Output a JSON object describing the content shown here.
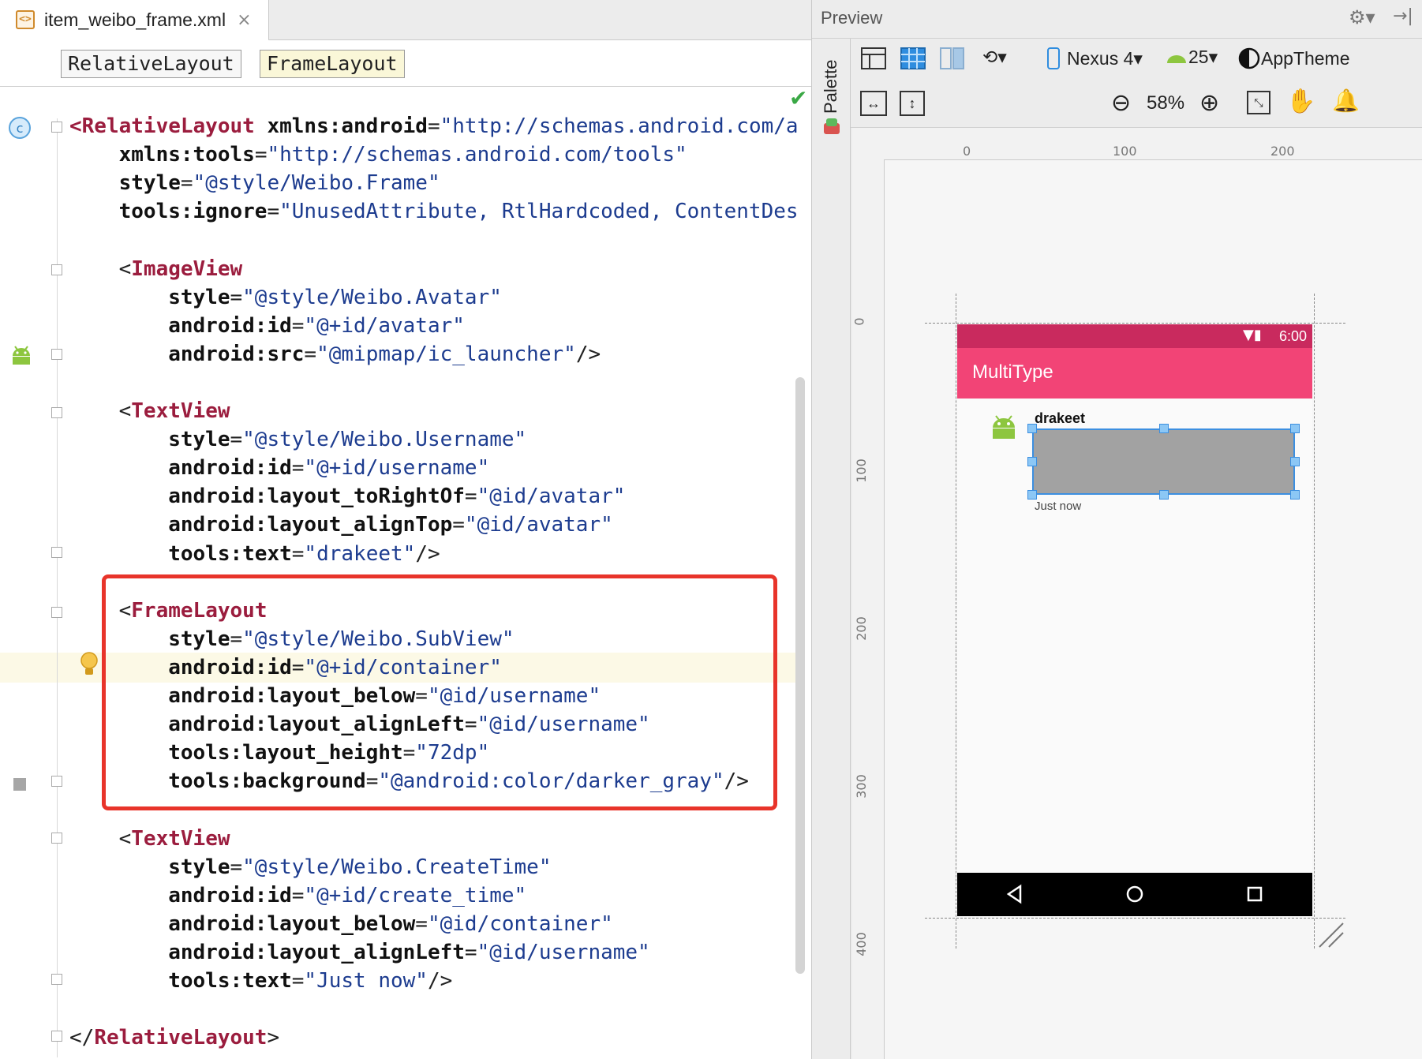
{
  "editor": {
    "file_tab": {
      "name": "item_weibo_frame.xml",
      "close": "×"
    },
    "breadcrumbs": [
      "RelativeLayout",
      "FrameLayout"
    ],
    "lines": [
      [
        [
          "tag",
          "<RelativeLayout "
        ],
        [
          "attr",
          "xmlns:android"
        ],
        [
          "plain",
          "="
        ],
        [
          "val",
          "\"http://schemas.android.com/a"
        ]
      ],
      [
        [
          "attr",
          "    xmlns:tools"
        ],
        [
          "plain",
          "="
        ],
        [
          "val",
          "\"http://schemas.android.com/tools\""
        ]
      ],
      [
        [
          "attr",
          "    style"
        ],
        [
          "plain",
          "="
        ],
        [
          "val",
          "\"@style/Weibo.Frame\""
        ]
      ],
      [
        [
          "attr",
          "    tools:ignore"
        ],
        [
          "plain",
          "="
        ],
        [
          "val",
          "\"UnusedAttribute, RtlHardcoded, ContentDes"
        ]
      ],
      [],
      [
        [
          "plain",
          "    <"
        ],
        [
          "tag",
          "ImageView"
        ]
      ],
      [
        [
          "attr",
          "        style"
        ],
        [
          "plain",
          "="
        ],
        [
          "val",
          "\"@style/Weibo.Avatar\""
        ]
      ],
      [
        [
          "attr",
          "        android:id"
        ],
        [
          "plain",
          "="
        ],
        [
          "val",
          "\"@+id/avatar\""
        ]
      ],
      [
        [
          "attr",
          "        android:src"
        ],
        [
          "plain",
          "="
        ],
        [
          "val",
          "\"@mipmap/ic_launcher\""
        ],
        [
          "plain",
          "/>"
        ]
      ],
      [],
      [
        [
          "plain",
          "    <"
        ],
        [
          "tag",
          "TextView"
        ]
      ],
      [
        [
          "attr",
          "        style"
        ],
        [
          "plain",
          "="
        ],
        [
          "val",
          "\"@style/Weibo.Username\""
        ]
      ],
      [
        [
          "attr",
          "        android:id"
        ],
        [
          "plain",
          "="
        ],
        [
          "val",
          "\"@+id/username\""
        ]
      ],
      [
        [
          "attr",
          "        android:layout_toRightOf"
        ],
        [
          "plain",
          "="
        ],
        [
          "val",
          "\"@id/avatar\""
        ]
      ],
      [
        [
          "attr",
          "        android:layout_alignTop"
        ],
        [
          "plain",
          "="
        ],
        [
          "val",
          "\"@id/avatar\""
        ]
      ],
      [
        [
          "attr",
          "        tools:text"
        ],
        [
          "plain",
          "="
        ],
        [
          "val",
          "\"drakeet\""
        ],
        [
          "plain",
          "/>"
        ]
      ],
      [],
      [
        [
          "plain",
          "    <"
        ],
        [
          "tag",
          "FrameLayout"
        ]
      ],
      [
        [
          "attr",
          "        style"
        ],
        [
          "plain",
          "="
        ],
        [
          "val",
          "\"@style/Weibo.SubView\""
        ]
      ],
      [
        [
          "attr",
          "        android:id"
        ],
        [
          "plain",
          "="
        ],
        [
          "val",
          "\"@+id/container\""
        ]
      ],
      [
        [
          "attr",
          "        android:layout_below"
        ],
        [
          "plain",
          "="
        ],
        [
          "val",
          "\"@id/username\""
        ]
      ],
      [
        [
          "attr",
          "        android:layout_alignLeft"
        ],
        [
          "plain",
          "="
        ],
        [
          "val",
          "\"@id/username\""
        ]
      ],
      [
        [
          "attr",
          "        tools:layout_height"
        ],
        [
          "plain",
          "="
        ],
        [
          "val",
          "\"72dp\""
        ]
      ],
      [
        [
          "attr",
          "        tools:background"
        ],
        [
          "plain",
          "="
        ],
        [
          "val",
          "\"@android:color/darker_gray\""
        ],
        [
          "plain",
          "/>"
        ]
      ],
      [],
      [
        [
          "plain",
          "    <"
        ],
        [
          "tag",
          "TextView"
        ]
      ],
      [
        [
          "attr",
          "        style"
        ],
        [
          "plain",
          "="
        ],
        [
          "val",
          "\"@style/Weibo.CreateTime\""
        ]
      ],
      [
        [
          "attr",
          "        android:id"
        ],
        [
          "plain",
          "="
        ],
        [
          "val",
          "\"@+id/create_time\""
        ]
      ],
      [
        [
          "attr",
          "        android:layout_below"
        ],
        [
          "plain",
          "="
        ],
        [
          "val",
          "\"@id/container\""
        ]
      ],
      [
        [
          "attr",
          "        android:layout_alignLeft"
        ],
        [
          "plain",
          "="
        ],
        [
          "val",
          "\"@id/username\""
        ]
      ],
      [
        [
          "attr",
          "        tools:text"
        ],
        [
          "plain",
          "="
        ],
        [
          "val",
          "\"Just now\""
        ],
        [
          "plain",
          "/>"
        ]
      ],
      [],
      [
        [
          "plain",
          "</"
        ],
        [
          "tag",
          "RelativeLayout"
        ],
        [
          "plain",
          ">"
        ]
      ]
    ]
  },
  "preview": {
    "title": "Preview",
    "palette_label": "Palette",
    "device": "Nexus 4",
    "api": "25",
    "theme": "AppTheme",
    "zoom": "58%",
    "ruler_h": [
      "0",
      "100",
      "200"
    ],
    "ruler_v": [
      "0",
      "100",
      "200",
      "300",
      "400"
    ],
    "app_title": "MultiType",
    "clock": "6:00",
    "username": "drakeet",
    "create_time": "Just now",
    "colors": {
      "status": "#c92a5e",
      "appbar": "#f24476",
      "highlight": "#e8342a"
    }
  }
}
